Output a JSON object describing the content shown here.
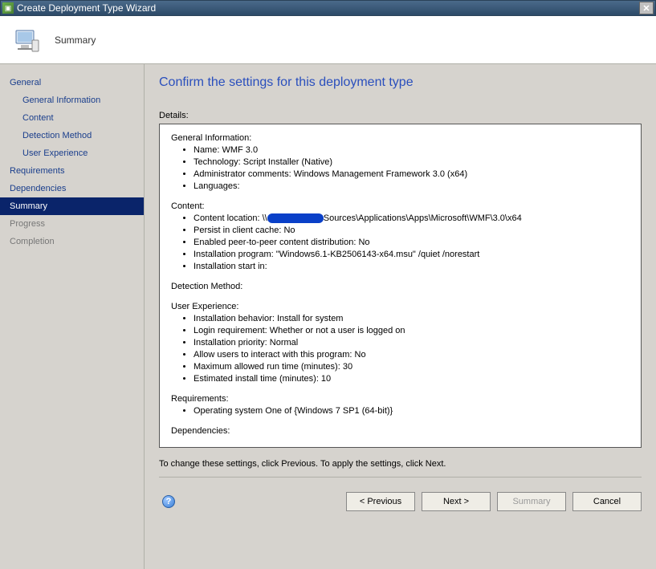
{
  "titlebar": {
    "title": "Create Deployment Type Wizard"
  },
  "header": {
    "page_name": "Summary"
  },
  "sidebar": {
    "items": [
      {
        "label": "General",
        "sub": false,
        "selected": false,
        "disabled": false
      },
      {
        "label": "General Information",
        "sub": true,
        "selected": false,
        "disabled": false
      },
      {
        "label": "Content",
        "sub": true,
        "selected": false,
        "disabled": false
      },
      {
        "label": "Detection Method",
        "sub": true,
        "selected": false,
        "disabled": false
      },
      {
        "label": "User Experience",
        "sub": true,
        "selected": false,
        "disabled": false
      },
      {
        "label": "Requirements",
        "sub": false,
        "selected": false,
        "disabled": false
      },
      {
        "label": "Dependencies",
        "sub": false,
        "selected": false,
        "disabled": false
      },
      {
        "label": "Summary",
        "sub": false,
        "selected": true,
        "disabled": false
      },
      {
        "label": "Progress",
        "sub": false,
        "selected": false,
        "disabled": true
      },
      {
        "label": "Completion",
        "sub": false,
        "selected": false,
        "disabled": true
      }
    ]
  },
  "content": {
    "heading": "Confirm the settings for this deployment type",
    "details_label": "Details:",
    "general_info": {
      "title": "General Information:",
      "name": "Name: WMF 3.0",
      "technology": "Technology: Script Installer (Native)",
      "admin_comments": "Administrator comments:  Windows Management Framework 3.0 (x64)",
      "languages": "Languages:"
    },
    "content_sect": {
      "title": "Content:",
      "location_prefix": "Content location: \\\\",
      "location_suffix": "Sources\\Applications\\Apps\\Microsoft\\WMF\\3.0\\x64",
      "persist": "Persist in client cache: No",
      "p2p": "Enabled peer-to-peer content distribution: No",
      "install_prog": "Installation program: \"Windows6.1-KB2506143-x64.msu\" /quiet /norestart",
      "install_start": "Installation start in:"
    },
    "detection": {
      "title": "Detection Method:"
    },
    "user_exp": {
      "title": "User Experience:",
      "behavior": "Installation behavior: Install for system",
      "login_req": "Login requirement: Whether or not a user is logged on",
      "priority": "Installation priority: Normal",
      "allow_interact": "Allow users to interact with this program: No",
      "max_runtime": "Maximum allowed run time (minutes): 30",
      "est_install": "Estimated install time (minutes): 10"
    },
    "requirements": {
      "title": "Requirements:",
      "os": "Operating system  One of {Windows 7 SP1 (64-bit)}"
    },
    "dependencies": {
      "title": "Dependencies:"
    },
    "footer_note": "To change these settings, click Previous. To apply the settings, click Next."
  },
  "buttons": {
    "previous": "< Previous",
    "next": "Next >",
    "summary": "Summary",
    "cancel": "Cancel"
  }
}
